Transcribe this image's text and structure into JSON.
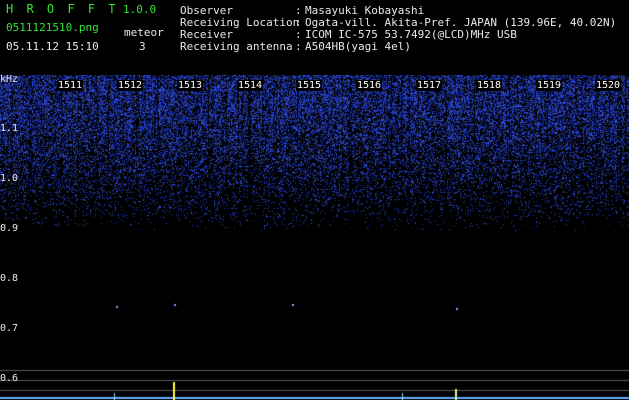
{
  "app": {
    "name": "H R O F F T",
    "version": "1.0.0"
  },
  "file": {
    "name": "0511121510.png",
    "date": "05.11.12 15:10"
  },
  "meteor": {
    "label": "meteor",
    "count": "3"
  },
  "info": [
    {
      "key": "Observer",
      "sep": ":",
      "value": "Masayuki Kobayashi"
    },
    {
      "key": "Receiving Location",
      "sep": ":",
      "value": "Ogata-vill. Akita-Pref. JAPAN (139.96E, 40.02N)"
    },
    {
      "key": "Receiver",
      "sep": ":",
      "value": "ICOM IC-575 53.7492(@LCD)MHz USB"
    },
    {
      "key": "Receiving antenna",
      "sep": ":",
      "value": "A504HB(yagi 4el)"
    }
  ],
  "freq_axis": {
    "unit": "kHz",
    "labels": [
      "1.1",
      "1.0",
      "0.9",
      "0.8",
      "0.7",
      "0.6"
    ]
  },
  "time_ticks": [
    "1511",
    "1512",
    "1513",
    "1514",
    "1515",
    "1516",
    "1517",
    "1518",
    "1519",
    "1520"
  ],
  "colors": {
    "noise": "#1e2dff",
    "text_green": "#2ee82e",
    "spike": "#ffff40"
  }
}
